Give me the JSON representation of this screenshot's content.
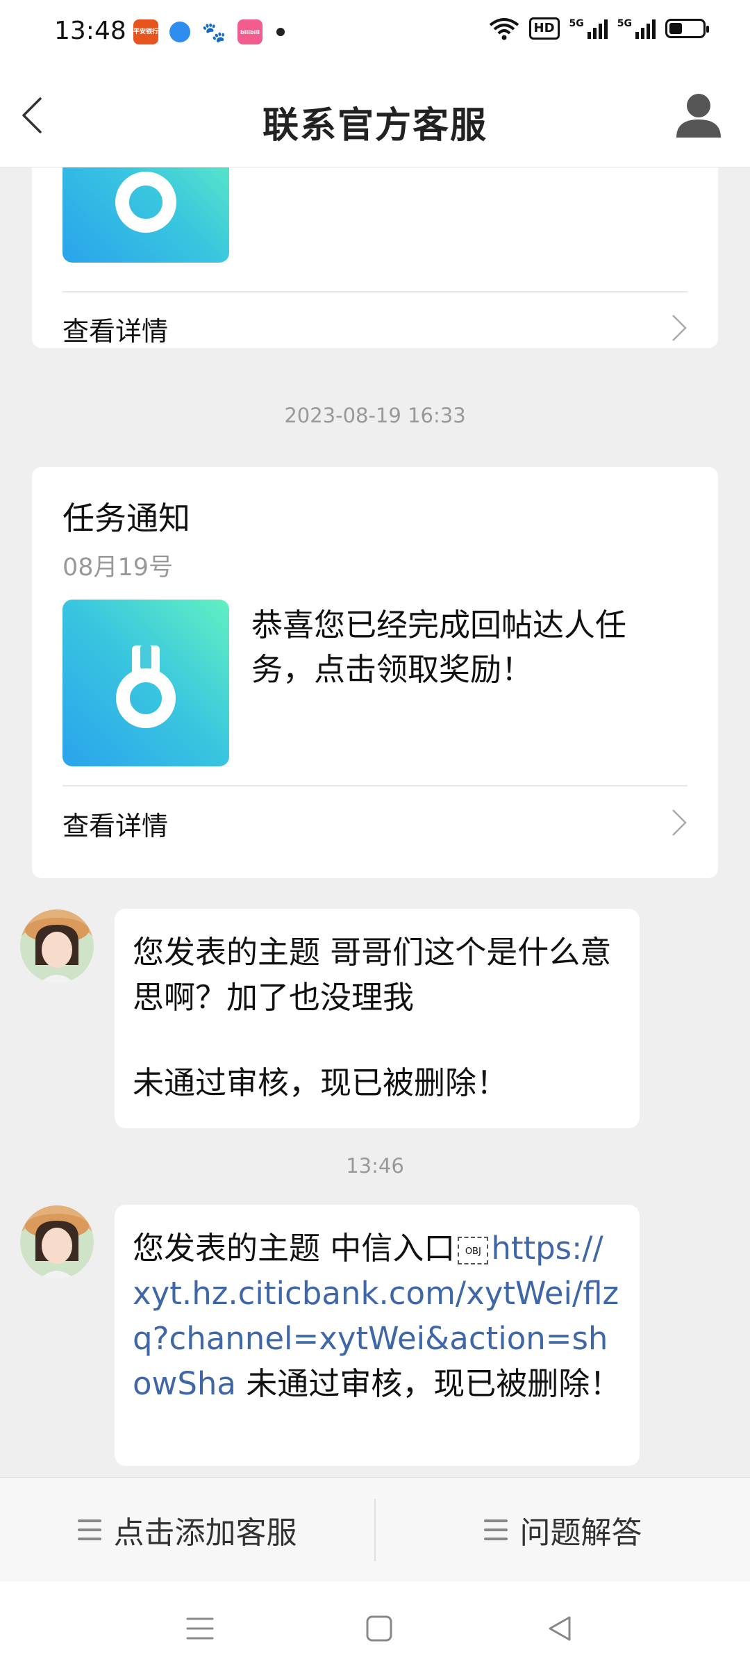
{
  "status_bar": {
    "time": "13:48",
    "app_icons": [
      "pingan-bank-icon",
      "blue-bubble-icon",
      "baidu-icon",
      "bilibili-icon"
    ],
    "pingan_label": "平安银行",
    "bili_label": "bilibili",
    "network_5g_1": "5G",
    "network_5g_2": "5G",
    "hd_label": "HD",
    "battery_level": 0.4
  },
  "header": {
    "title": "联系官方客服"
  },
  "card_top": {
    "view_details": "查看详情"
  },
  "timestamp_1": "2023-08-19 16:33",
  "task_card": {
    "title": "任务通知",
    "date": "08月19号",
    "message": "恭喜您已经完成回帖达人任务，点击领取奖励！",
    "view_details": "查看详情"
  },
  "messages": [
    {
      "line1": "您发表的主题 哥哥们这个是什么意思啊？加了也没理我",
      "line2": "未通过审核，现已被删除！"
    },
    {
      "prefix": "您发表的主题 中信入口",
      "obj_label": "OBJ",
      "link": "https://xyt.hz.citicbank.com/xytWei/flzq?channel=xytWei&action=showSha",
      "suffix": " 未通过审核，现已被删除！"
    }
  ],
  "timestamp_2": "13:46",
  "bottom_bar": {
    "left_label": "点击添加客服",
    "right_label": "问题解答"
  },
  "colors": {
    "link": "#3f67a8",
    "background": "#efefef",
    "tile_gradient_start": "#62f0c2",
    "tile_gradient_end": "#2aa3ec"
  }
}
